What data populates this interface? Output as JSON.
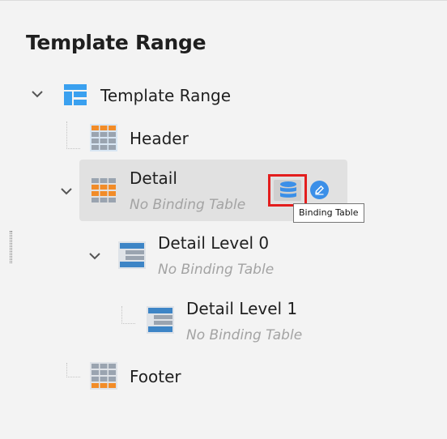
{
  "panel": {
    "title": "Template Range"
  },
  "tree": {
    "root": {
      "label": "Template Range",
      "icon": "template-range-icon"
    },
    "header": {
      "label": "Header",
      "icon": "header-grid-icon"
    },
    "detail": {
      "label": "Detail",
      "sublabel": "No Binding Table",
      "icon": "detail-grid-icon"
    },
    "detail_level_0": {
      "label": "Detail Level 0",
      "sublabel": "No Binding Table",
      "icon": "detail-level-icon"
    },
    "detail_level_1": {
      "label": "Detail Level 1",
      "sublabel": "No Binding Table",
      "icon": "detail-level-icon"
    },
    "footer": {
      "label": "Footer",
      "icon": "footer-grid-icon"
    }
  },
  "actions": {
    "binding_table_icon": "database-icon",
    "edit_icon": "pencil-icon",
    "tooltip": "Binding Table"
  },
  "colors": {
    "accent_blue": "#3b8fe8",
    "orange": "#f28c28",
    "highlight_red": "#e31e1e",
    "selection": "#e1e1e1"
  }
}
